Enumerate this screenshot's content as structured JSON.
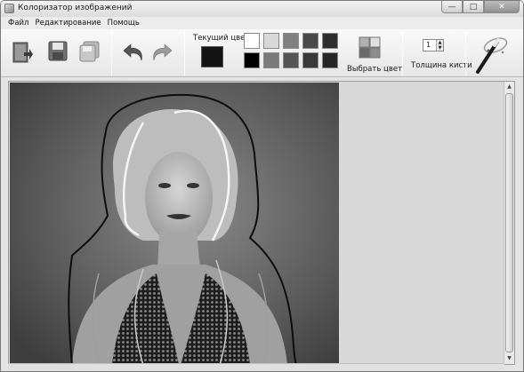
{
  "window": {
    "title": "Колоризатор изображений"
  },
  "window_controls": {
    "minimize": "—",
    "maximize": "□",
    "close": "✕"
  },
  "menu": [
    "Файл",
    "Редактирование",
    "Помощь"
  ],
  "toolbar": {
    "current_color_label": "Текущий цвет",
    "current_color": "#141414",
    "palette": [
      "#ffffff",
      "#d8d8d8",
      "#808080",
      "#4a4a4a",
      "#2e2e2e",
      "#c4c4c4",
      "#000000",
      "#7a7a7a",
      "#555555",
      "#3a3a3a",
      "#262626",
      "#333333"
    ],
    "pick_color_label": "Выбрать цвет",
    "brush_thickness": "1",
    "brush_thickness_label": "Толщина кисти"
  },
  "icons": {
    "open": "open-file-icon",
    "save": "save-icon",
    "save_as": "save-as-icon",
    "undo": "undo-icon",
    "redo": "redo-icon",
    "pick_color": "color-picker-icon",
    "colorize": "magic-wand-icon"
  }
}
